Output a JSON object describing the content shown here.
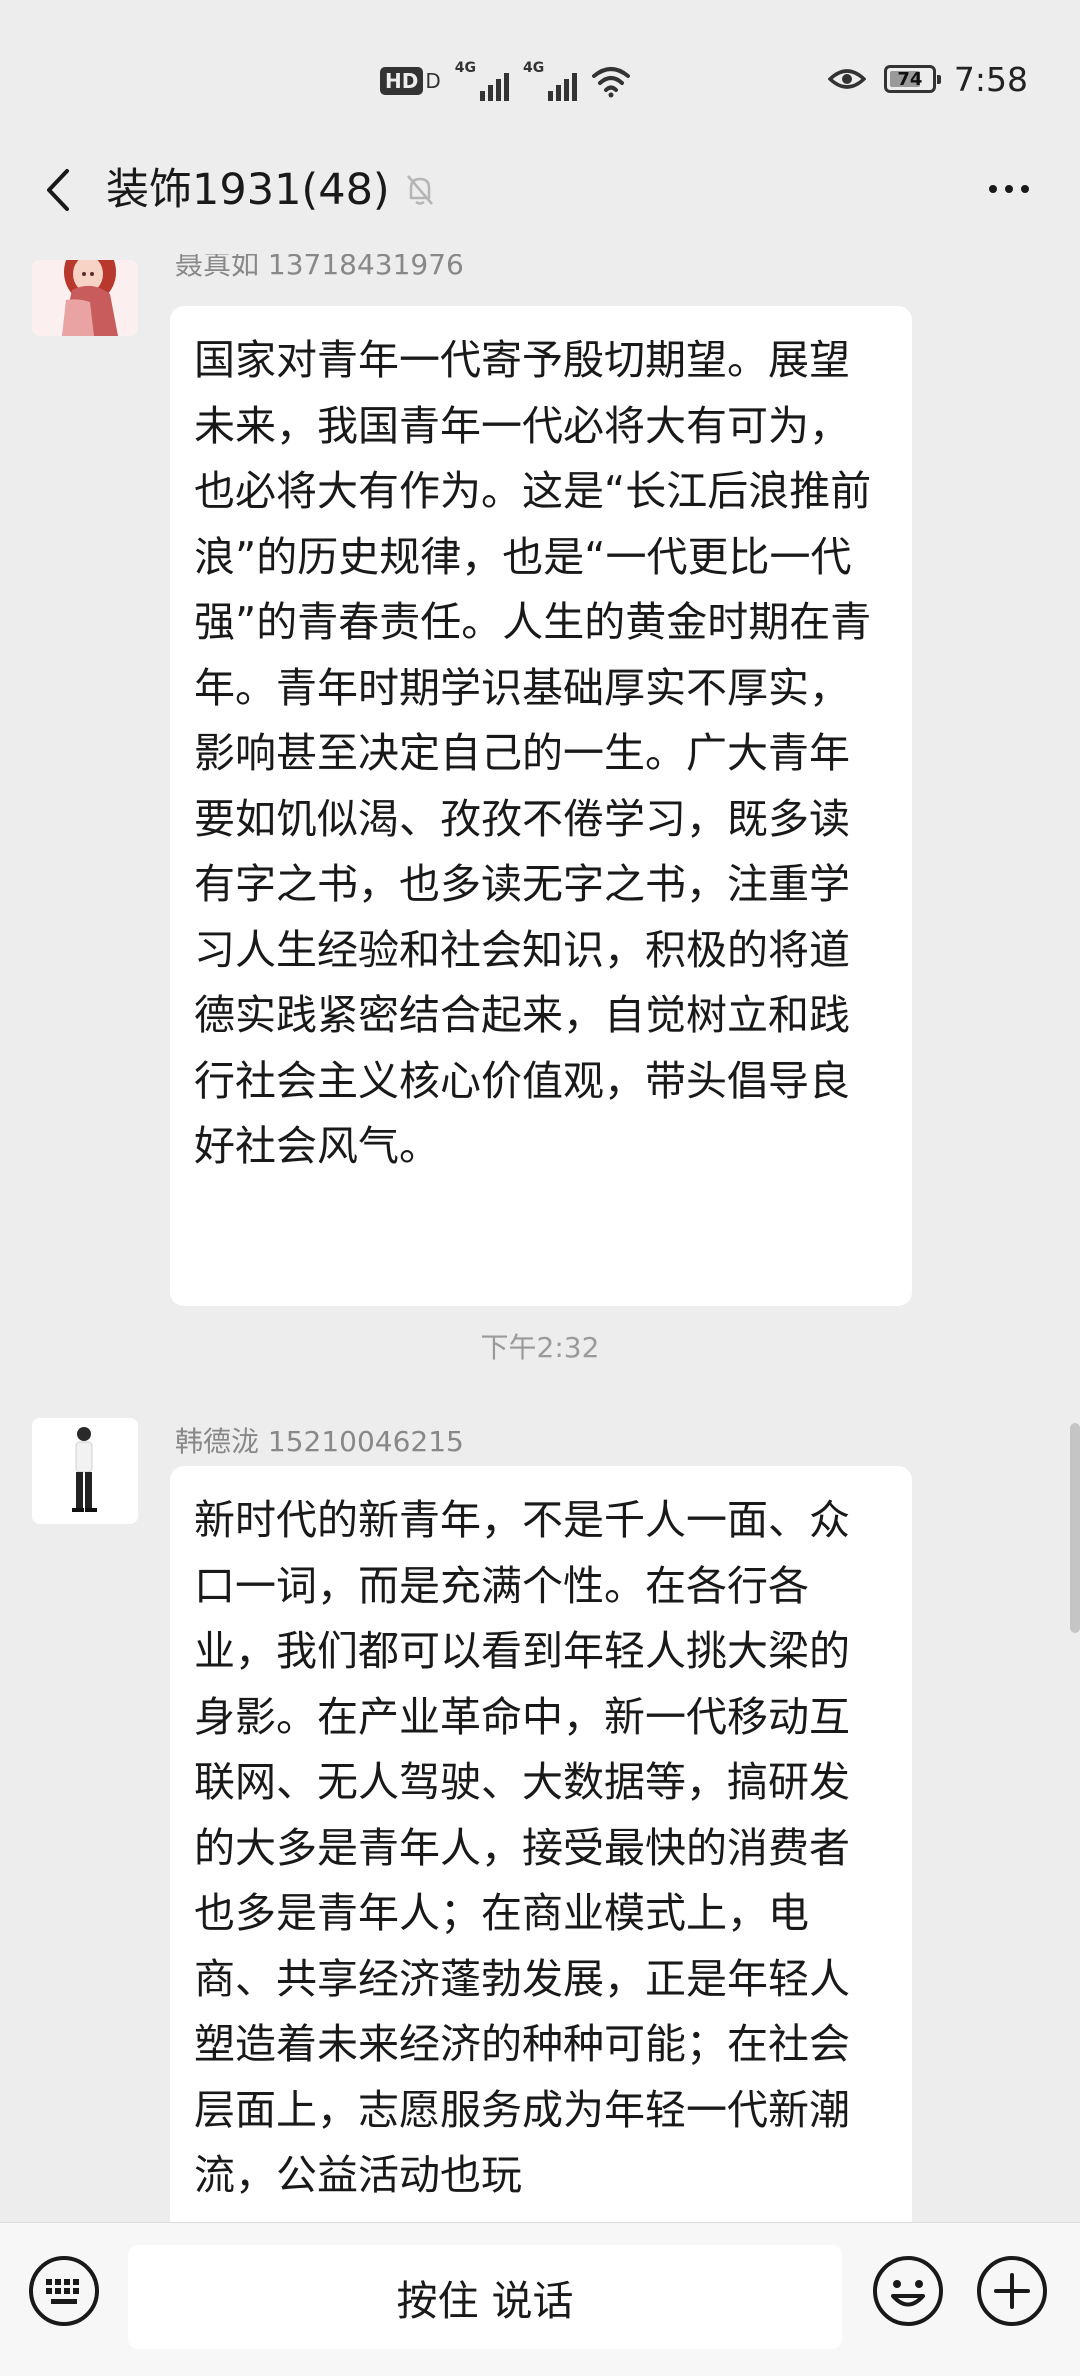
{
  "status_bar": {
    "hd_badge": "HD",
    "hd_sub": "D",
    "network1": "4G",
    "network2": "4G",
    "battery_level": "74",
    "battery_fraction": 0.74,
    "time": "7:58"
  },
  "header": {
    "title": "装饰1931(48)",
    "back_icon": "chevron-left-icon",
    "mute_icon": "bell-off-icon",
    "more_icon": "more-dots-icon"
  },
  "messages": [
    {
      "sender": "聂真如 13718431976",
      "text": "国家对青年一代寄予殷切期望。展望未来，我国青年一代必将大有可为，也必将大有作为。这是“长江后浪推前浪”的历史规律，也是“一代更比一代强”的青春责任。人生的黄金时期在青年。青年时期学识基础厚实不厚实，影响甚至决定自己的一生。广大青年要如饥似渴、孜孜不倦学习，既多读有字之书，也多读无字之书，注重学习人生经验和社会知识，积极的将道德实践紧密结合起来，自觉树立和践行社会主义核心价值观，带头倡导良好社会风气。"
    },
    {
      "sender": "韩德泷 15210046215",
      "text": "新时代的新青年，不是千人一面、众口一词，而是充满个性。在各行各业，我们都可以看到年轻人挑大梁的身影。在产业革命中，新一代移动互联网、无人驾驶、大数据等，搞研发的大多是青年人，接受最快的消费者也多是青年人；在商业模式上，电商、共享经济蓬勃发展，正是年轻人塑造着未来经济的种种可能；在社会层面上，志愿服务成为年轻一代新潮流，公益活动也玩"
    }
  ],
  "timestamp": "下午2:32",
  "input_bar": {
    "hold_to_talk": "按住 说话",
    "keyboard_icon": "keyboard-icon",
    "emoji_icon": "emoji-icon",
    "plus_icon": "plus-icon"
  },
  "colors": {
    "background": "#EDEDED",
    "bubble": "#FFFFFF",
    "text": "#191919",
    "meta": "#888888"
  }
}
